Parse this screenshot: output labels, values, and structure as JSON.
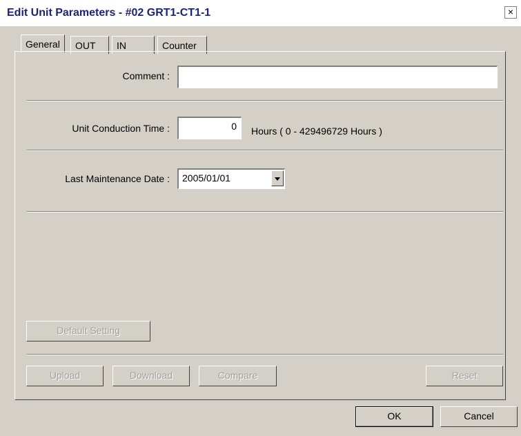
{
  "window": {
    "title": "Edit Unit Parameters - #02 GRT1-CT1-1",
    "close_glyph": "×"
  },
  "tabs": [
    {
      "label": "General",
      "active": true
    },
    {
      "label": "OUT"
    },
    {
      "label": "IN"
    },
    {
      "label": "Counter"
    }
  ],
  "general": {
    "comment_label": "Comment :",
    "comment_value": "",
    "conduction_label": "Unit Conduction Time :",
    "conduction_value": "0",
    "conduction_hint": "Hours ( 0 - 429496729 Hours )",
    "maintenance_label": "Last Maintenance Date :",
    "maintenance_value": "2005/01/01"
  },
  "buttons": {
    "default_setting": "Default Setting",
    "upload": "Upload",
    "download": "Download",
    "compare": "Compare",
    "reset": "Reset",
    "ok": "OK",
    "cancel": "Cancel"
  }
}
